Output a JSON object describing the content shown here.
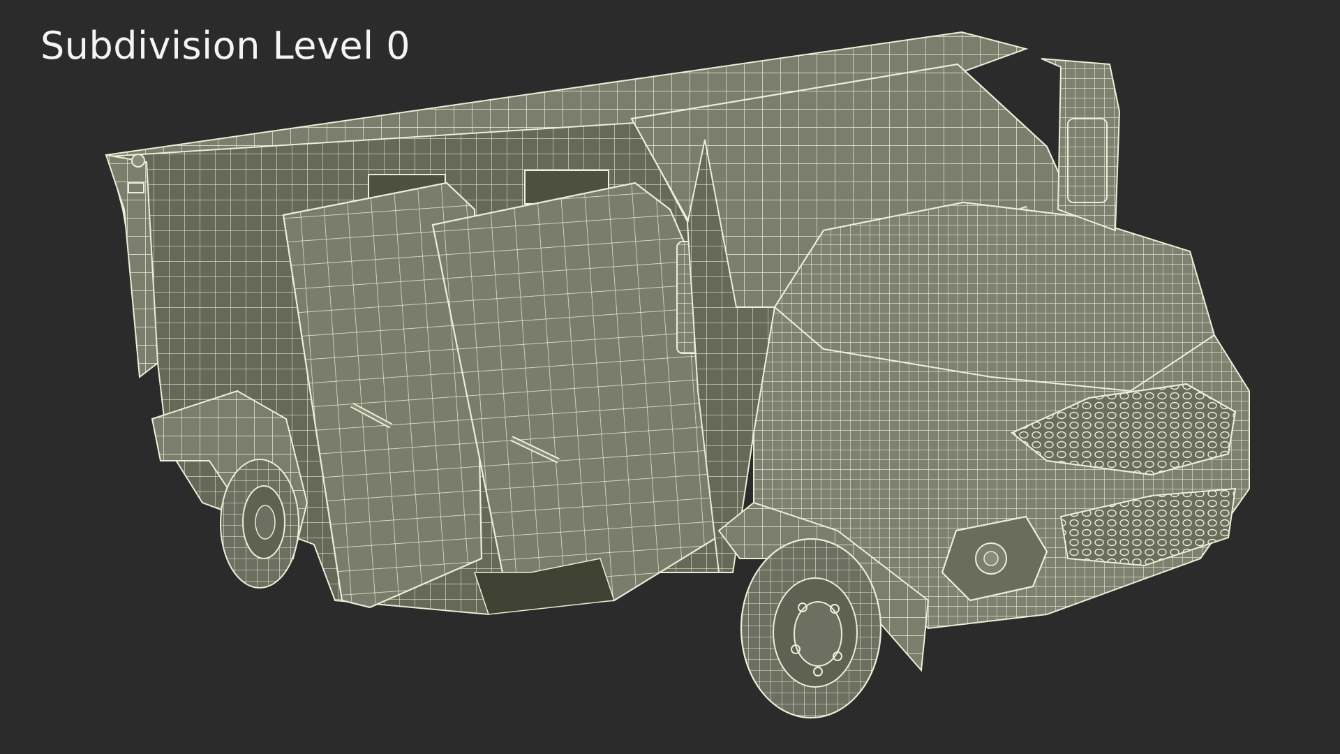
{
  "caption": "Subdivision Level 0",
  "subject": "armored-van-wireframe",
  "colors": {
    "background": "#2b2b2b",
    "surface": "#7b7e6c",
    "surface_dark": "#686b5b",
    "wire": "#eeedd8",
    "caption_text": "#f4f4f4"
  }
}
